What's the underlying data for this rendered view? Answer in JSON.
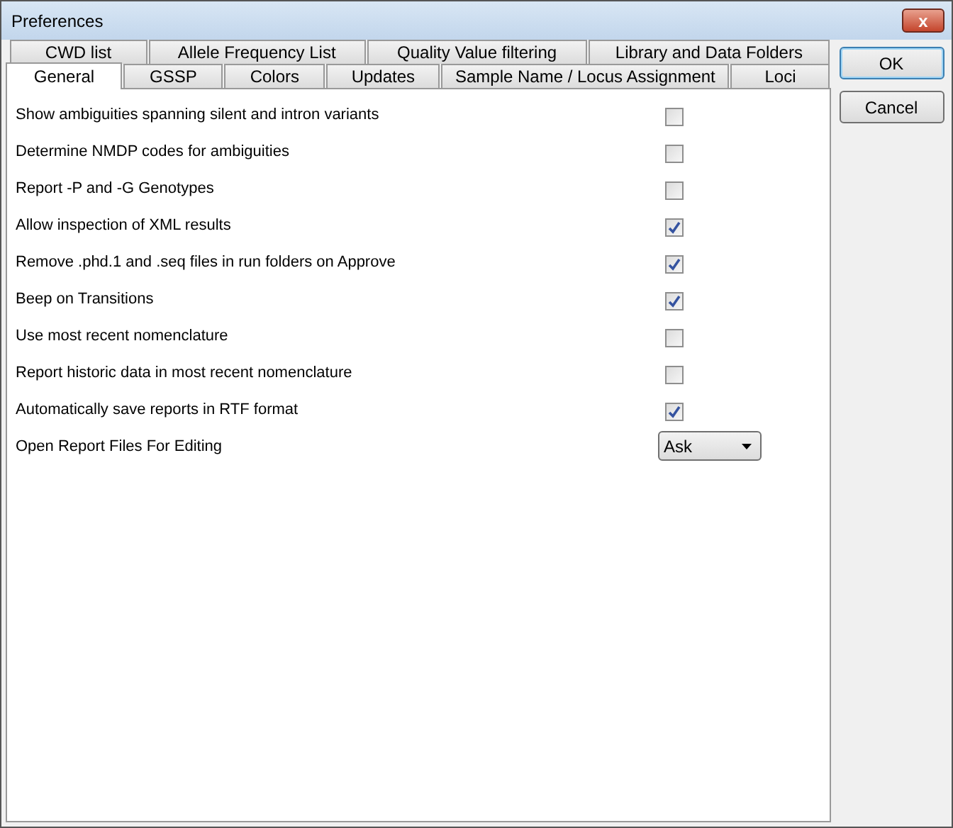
{
  "window": {
    "title": "Preferences",
    "close_label": "x"
  },
  "tab_rows": [
    [
      {
        "label": "CWD list",
        "selected": false
      },
      {
        "label": "Allele Frequency List",
        "selected": false
      },
      {
        "label": "Quality Value filtering",
        "selected": false
      },
      {
        "label": "Library and Data Folders",
        "selected": false
      }
    ],
    [
      {
        "label": "General",
        "selected": true
      },
      {
        "label": "GSSP",
        "selected": false
      },
      {
        "label": "Colors",
        "selected": false
      },
      {
        "label": "Updates",
        "selected": false
      },
      {
        "label": "Sample Name / Locus Assignment",
        "selected": false
      },
      {
        "label": "Loci",
        "selected": false
      }
    ]
  ],
  "settings": [
    {
      "kind": "checkbox",
      "label": "Show ambiguities spanning silent and intron variants",
      "checked": false
    },
    {
      "kind": "checkbox",
      "label": "Determine NMDP codes for ambiguities",
      "checked": false
    },
    {
      "kind": "checkbox",
      "label": "Report -P and -G Genotypes",
      "checked": false
    },
    {
      "kind": "checkbox",
      "label": "Allow inspection of XML results",
      "checked": true
    },
    {
      "kind": "checkbox",
      "label": "Remove .phd.1 and .seq files in run folders on Approve",
      "checked": true
    },
    {
      "kind": "checkbox",
      "label": "Beep on Transitions",
      "checked": true
    },
    {
      "kind": "checkbox",
      "label": "Use most recent nomenclature",
      "checked": false
    },
    {
      "kind": "checkbox",
      "label": "Report historic data in most recent nomenclature",
      "checked": false
    },
    {
      "kind": "checkbox",
      "label": "Automatically save reports in RTF format",
      "checked": true
    },
    {
      "kind": "dropdown",
      "label": "Open Report Files For Editing",
      "value": "Ask"
    }
  ],
  "buttons": [
    "OK",
    "Cancel"
  ]
}
